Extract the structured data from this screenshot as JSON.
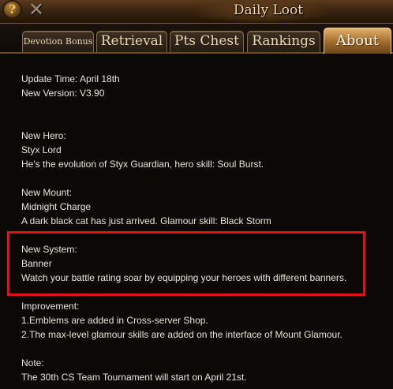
{
  "window": {
    "title": "Daily Loot",
    "help_label": "?",
    "close_label": "✕",
    "icons": [
      "help-icon",
      "close-icon"
    ]
  },
  "tabs": [
    {
      "label": "Devotion Bonus",
      "active": false
    },
    {
      "label": "Retrieval",
      "active": false
    },
    {
      "label": "Pts Chest",
      "active": false
    },
    {
      "label": "Rankings",
      "active": false
    },
    {
      "label": "About",
      "active": true
    }
  ],
  "about": {
    "update_time": "Update Time: April 18th",
    "new_version": "New Version: V3.90",
    "hero": {
      "heading": "New Hero:",
      "name": "Styx Lord",
      "desc": "He's the evolution of Styx Guardian, hero skill: Soul Burst."
    },
    "mount": {
      "heading": "New Mount:",
      "name": "Midnight Charge",
      "desc": "A dark black cat has just arrived. Glamour skill: Black Storm"
    },
    "system": {
      "heading": "New System:",
      "name": "Banner",
      "desc": "Watch your battle rating soar by equipping your heroes with different banners."
    },
    "improvement": {
      "heading": "Improvement:",
      "item1": "1.Emblems are added in Cross-server Shop.",
      "item2": "2.The max-level glamour skills are added on the interface of Mount Glamour."
    },
    "note": {
      "heading": "Note:",
      "text": "The 30th CS Team Tournament will start on April 21st."
    }
  },
  "colors": {
    "highlight": "#e01414",
    "active_tab": "#c08a44",
    "text": "#e9e4da"
  }
}
